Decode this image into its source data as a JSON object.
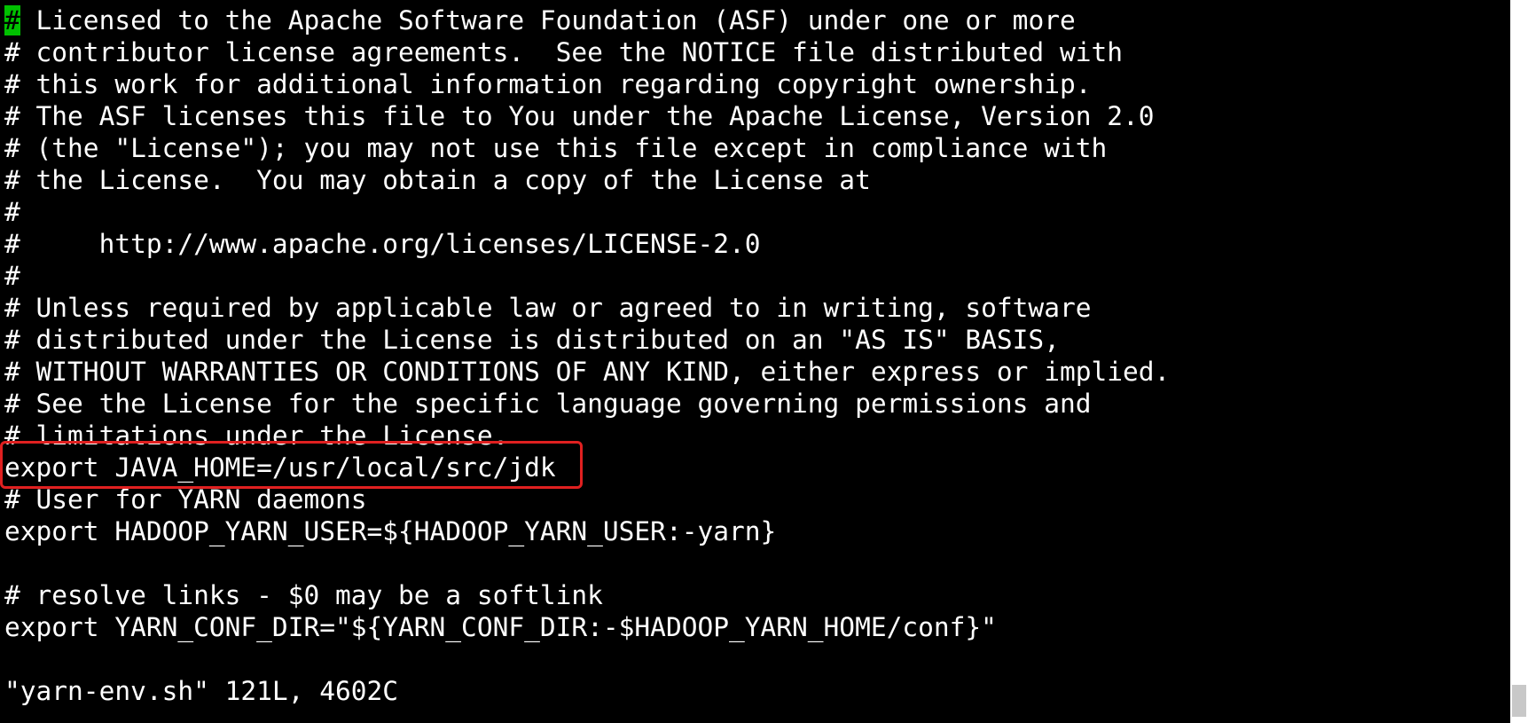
{
  "editor": {
    "cursor_char": "#",
    "lines": [
      " Licensed to the Apache Software Foundation (ASF) under one or more",
      "# contributor license agreements.  See the NOTICE file distributed with",
      "# this work for additional information regarding copyright ownership.",
      "# The ASF licenses this file to You under the Apache License, Version 2.0",
      "# (the \"License\"); you may not use this file except in compliance with",
      "# the License.  You may obtain a copy of the License at",
      "#",
      "#     http://www.apache.org/licenses/LICENSE-2.0",
      "#",
      "# Unless required by applicable law or agreed to in writing, software",
      "# distributed under the License is distributed on an \"AS IS\" BASIS,",
      "# WITHOUT WARRANTIES OR CONDITIONS OF ANY KIND, either express or implied.",
      "# See the License for the specific language governing permissions and",
      "# limitations under the License.",
      "export JAVA_HOME=/usr/local/src/jdk",
      "# User for YARN daemons",
      "export HADOOP_YARN_USER=${HADOOP_YARN_USER:-yarn}",
      "",
      "# resolve links - $0 may be a softlink",
      "export YARN_CONF_DIR=\"${YARN_CONF_DIR:-$HADOOP_YARN_HOME/conf}\"",
      ""
    ],
    "status_line": "\"yarn-env.sh\" 121L, 4602C"
  },
  "colors": {
    "background": "#000000",
    "text": "#ffffff",
    "cursor": "#00c000",
    "highlight_border": "#e02020"
  }
}
